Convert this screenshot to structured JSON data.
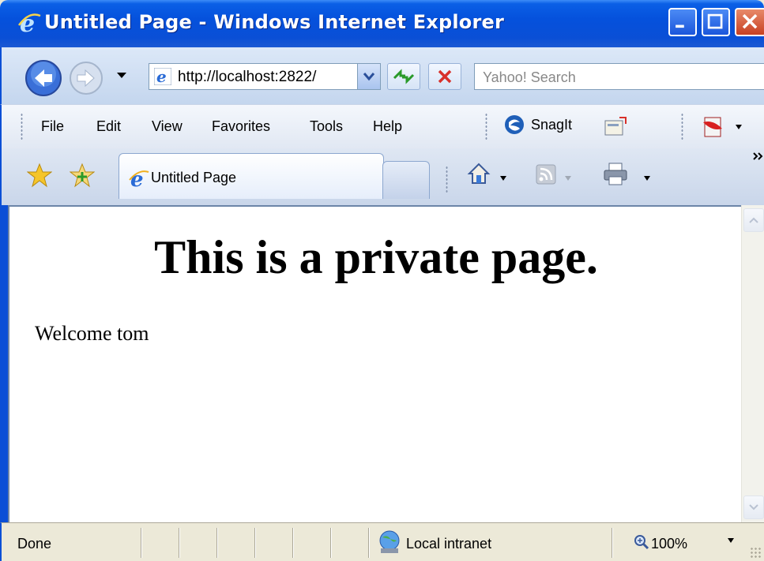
{
  "window": {
    "title": "Untitled Page - Windows Internet Explorer"
  },
  "toolbar": {
    "address": "http://localhost:2822/",
    "search_placeholder": "Yahoo! Search"
  },
  "menu": {
    "items": [
      "File",
      "Edit",
      "View",
      "Favorites",
      "Tools",
      "Help"
    ],
    "snagit_label": "SnagIt"
  },
  "tabs": [
    {
      "label": "Untitled Page"
    }
  ],
  "content": {
    "heading": "This is a private page.",
    "welcome": "Welcome tom"
  },
  "status": {
    "text": "Done",
    "zone": "Local intranet",
    "zoom": "100%"
  },
  "colors": {
    "titlebar": "#0551dc",
    "background": "#ece9d8"
  },
  "icons": [
    "ie-icon",
    "back-arrow-icon",
    "forward-arrow-icon",
    "refresh-icon",
    "stop-icon",
    "snagit-icon",
    "pdf-icon",
    "favorites-star-icon",
    "add-favorites-icon",
    "home-icon",
    "feed-icon",
    "print-icon",
    "intranet-globe-icon",
    "zoom-icon"
  ]
}
